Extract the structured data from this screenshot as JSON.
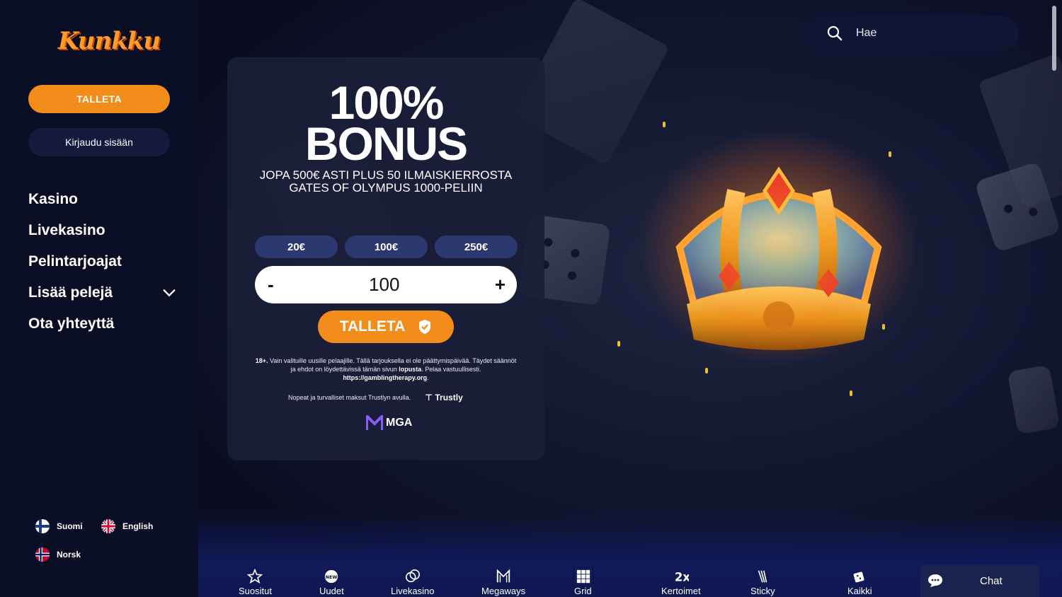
{
  "brand": {
    "logo_text": "Kunkku"
  },
  "sidebar": {
    "deposit_button": "TALLETA",
    "login_button": "Kirjaudu sisään",
    "nav": [
      {
        "label": "Kasino"
      },
      {
        "label": "Livekasino"
      },
      {
        "label": "Pelintarjoajat"
      },
      {
        "label": "Lisää pelejä",
        "expandable": true
      },
      {
        "label": "Ota yhteyttä"
      }
    ],
    "languages": [
      {
        "label": "Suomi",
        "flag": "fi"
      },
      {
        "label": "English",
        "flag": "gb"
      },
      {
        "label": "Norsk",
        "flag": "no"
      }
    ]
  },
  "search": {
    "placeholder": "Hae"
  },
  "promo": {
    "headline_line1": "100%",
    "headline_line2": "BONUS",
    "subtitle": "JOPA 500€ ASTI PLUS 50 ILMAISKIERROSTA GATES OF OLYMPUS 1000-PELIIN",
    "amount_options": [
      "20€",
      "100€",
      "250€"
    ],
    "amount_value": "100",
    "minus_label": "-",
    "plus_label": "+",
    "deposit_button": "TALLETA",
    "terms_age": "18+.",
    "terms_text_1": " Vain valituille uusille pelaajille. Tällä tarjouksella ei ole päättymispäivää. Täydet säännöt ja ehdot on löydettävissä tämän sivun ",
    "terms_link": "lopusta",
    "terms_text_2": ". Pelaa vastuullisesti. ",
    "terms_url": "https://gamblingtherapy.org",
    "terms_end": ".",
    "payments_text": "Nopeat ja turvalliset maksut Trustlyn avulla.",
    "trustly_label": "Trustly",
    "mga_label": "MGA"
  },
  "bottom_nav": [
    {
      "label": "Suositut",
      "icon": "star-icon"
    },
    {
      "label": "Uudet",
      "icon": "new-badge-icon"
    },
    {
      "label": "Livekasino",
      "icon": "chips-icon"
    },
    {
      "label": "Megaways",
      "icon": "megaways-icon"
    },
    {
      "label": "Grid Pelit",
      "icon": "grid-icon"
    },
    {
      "label": "Kertoimet",
      "icon": "multiplier-icon"
    },
    {
      "label": "Sticky Wilds",
      "icon": "sticky-wilds-icon"
    },
    {
      "label": "Kaikki Pelit",
      "icon": "dice-icon"
    }
  ],
  "chat": {
    "label": "Chat"
  },
  "colors": {
    "accent": "#f28c1b",
    "background": "#0b0f26",
    "panel": "#1a1e38",
    "chip": "#2c3970"
  }
}
